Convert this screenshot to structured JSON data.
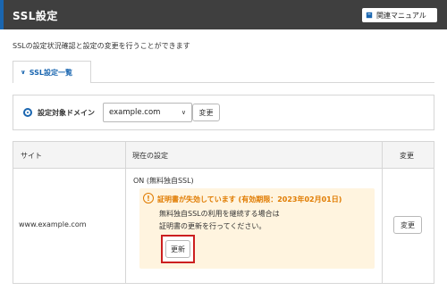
{
  "header": {
    "title": "SSL設定",
    "manual_button": "関連マニュアル",
    "manual_icon": "book-icon"
  },
  "description": "SSLの設定状況確認と設定の変更を行うことができます",
  "tabs": [
    {
      "label": "SSL設定一覧",
      "active": true,
      "icon": "chevron-down-icon"
    }
  ],
  "domain_selector": {
    "label": "設定対象ドメイン",
    "selected_value": "example.com",
    "change_button": "変更"
  },
  "table": {
    "headers": [
      "サイト",
      "現在の設定",
      "変更"
    ],
    "rows": [
      {
        "site": "www.example.com",
        "status": "ON (無料独自SSL)",
        "warning": {
          "title": "証明書が失効しています (有効期限：2023年02月01日)",
          "line1": "無料独自SSLの利用を継続する場合は",
          "line2": "証明書の更新を行ってください。",
          "renew_button": "更新"
        },
        "change_button": "変更"
      }
    ]
  },
  "colors": {
    "header_bg": "#3f3f3f",
    "accent": "#1a66b0",
    "warning": "#e07b00",
    "warning_bg": "#fff4df",
    "highlight": "#cc1f1f"
  }
}
